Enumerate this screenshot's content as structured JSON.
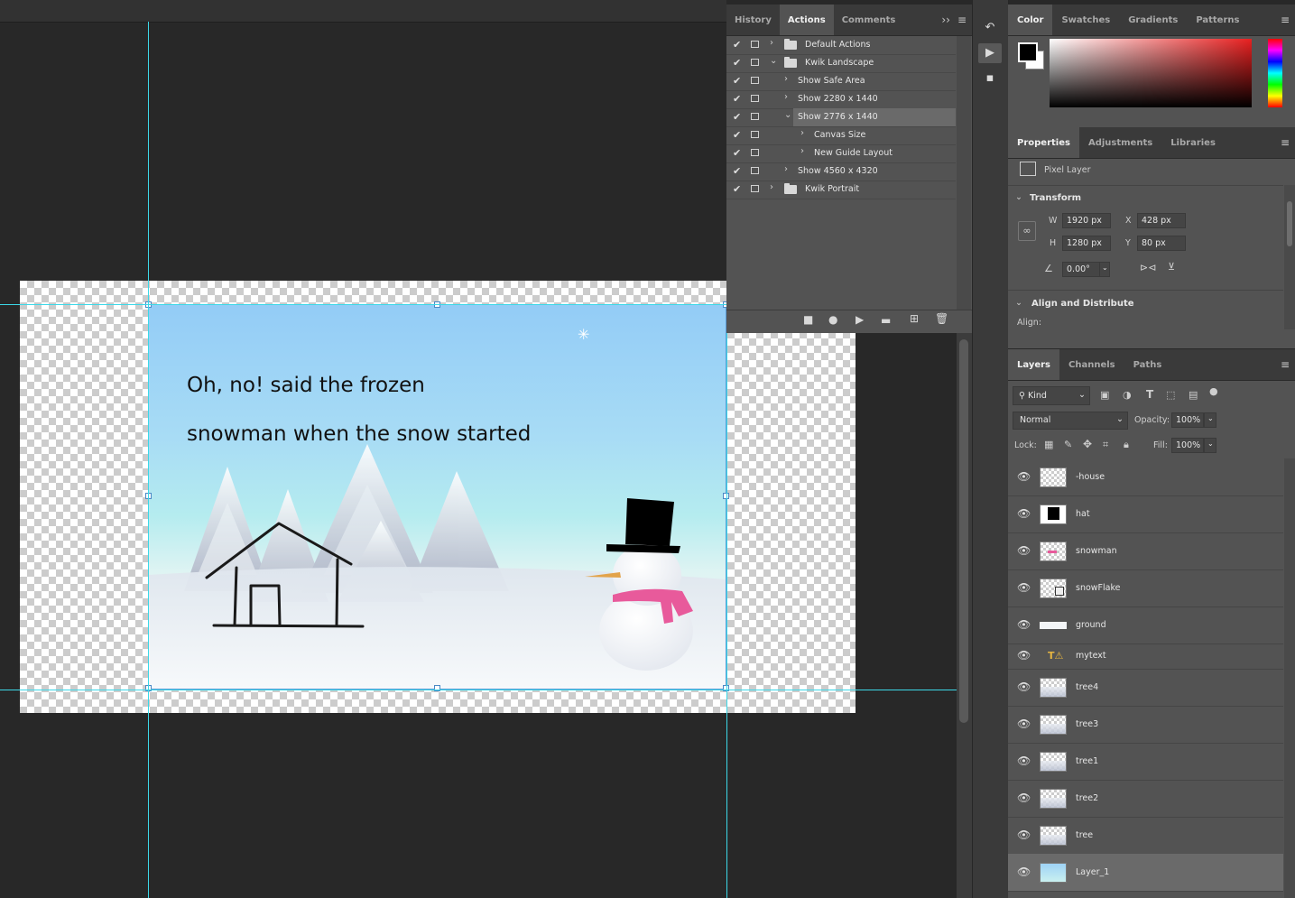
{
  "canvas": {
    "caption_line1": "Oh, no! said the frozen",
    "caption_line2": "snowman when the snow started",
    "snowflake": "✳"
  },
  "actions_panel": {
    "tabs": [
      {
        "label": "History",
        "active": false
      },
      {
        "label": "Actions",
        "active": true
      },
      {
        "label": "Comments",
        "active": false
      }
    ],
    "expand_glyph": "››",
    "items": [
      {
        "label": "Default Actions",
        "type": "set",
        "expanded": false,
        "indent": 0
      },
      {
        "label": "Kwik Landscape",
        "type": "set",
        "expanded": true,
        "indent": 0
      },
      {
        "label": "Show Safe Area",
        "type": "action",
        "expanded": false,
        "indent": 1
      },
      {
        "label": "Show 2280 x 1440",
        "type": "action",
        "expanded": false,
        "indent": 1
      },
      {
        "label": "Show 2776 x 1440",
        "type": "action",
        "expanded": true,
        "indent": 1,
        "selected": true
      },
      {
        "label": "Canvas Size",
        "type": "step",
        "expanded": false,
        "indent": 2
      },
      {
        "label": "New Guide Layout",
        "type": "step",
        "expanded": false,
        "indent": 2
      },
      {
        "label": "Show 4560 x 4320",
        "type": "action",
        "expanded": false,
        "indent": 1
      },
      {
        "label": "Kwik Portrait",
        "type": "set",
        "expanded": false,
        "indent": 0
      }
    ],
    "bottom_buttons": [
      "stop-icon",
      "record-icon",
      "play-icon",
      "folder-icon",
      "new-action-icon",
      "trash-icon"
    ]
  },
  "color_panel": {
    "tabs": [
      {
        "label": "Color",
        "active": true
      },
      {
        "label": "Swatches",
        "active": false
      },
      {
        "label": "Gradients",
        "active": false
      },
      {
        "label": "Patterns",
        "active": false
      }
    ],
    "foreground": "#000000",
    "background": "#ffffff",
    "hue_base": "#e82020"
  },
  "properties_panel": {
    "tabs": [
      {
        "label": "Properties",
        "active": true
      },
      {
        "label": "Adjustments",
        "active": false
      },
      {
        "label": "Libraries",
        "active": false
      }
    ],
    "layer_kind": "Pixel Layer",
    "transform_title": "Transform",
    "w_label": "W",
    "w_value": "1920 px",
    "h_label": "H",
    "h_value": "1280 px",
    "x_label": "X",
    "x_value": "428 px",
    "y_label": "Y",
    "y_value": "80 px",
    "angle_value": "0.00°",
    "align_title": "Align and Distribute",
    "align_label": "Align:"
  },
  "layers_panel": {
    "tabs": [
      {
        "label": "Layers",
        "active": true
      },
      {
        "label": "Channels",
        "active": false
      },
      {
        "label": "Paths",
        "active": false
      }
    ],
    "filter_kind": "Kind",
    "blend_mode": "Normal",
    "opacity_label": "Opacity:",
    "opacity_value": "100%",
    "lock_label": "Lock:",
    "fill_label": "Fill:",
    "fill_value": "100%",
    "layers": [
      {
        "name": "-house",
        "thumb": "transparent",
        "selected": false
      },
      {
        "name": "hat",
        "thumb": "hat",
        "selected": false
      },
      {
        "name": "snowman",
        "thumb": "snowman",
        "selected": false
      },
      {
        "name": "snowFlake",
        "thumb": "smart",
        "selected": false
      },
      {
        "name": "ground",
        "thumb": "ground",
        "selected": false
      },
      {
        "name": "mytext",
        "thumb": "text-warning",
        "selected": false
      },
      {
        "name": "tree4",
        "thumb": "tree",
        "selected": false
      },
      {
        "name": "tree3",
        "thumb": "tree",
        "selected": false
      },
      {
        "name": "tree1",
        "thumb": "tree",
        "selected": false
      },
      {
        "name": "tree2",
        "thumb": "tree",
        "selected": false
      },
      {
        "name": "tree",
        "thumb": "tree",
        "selected": false
      },
      {
        "name": "Layer_1",
        "thumb": "sky",
        "selected": true
      }
    ]
  }
}
